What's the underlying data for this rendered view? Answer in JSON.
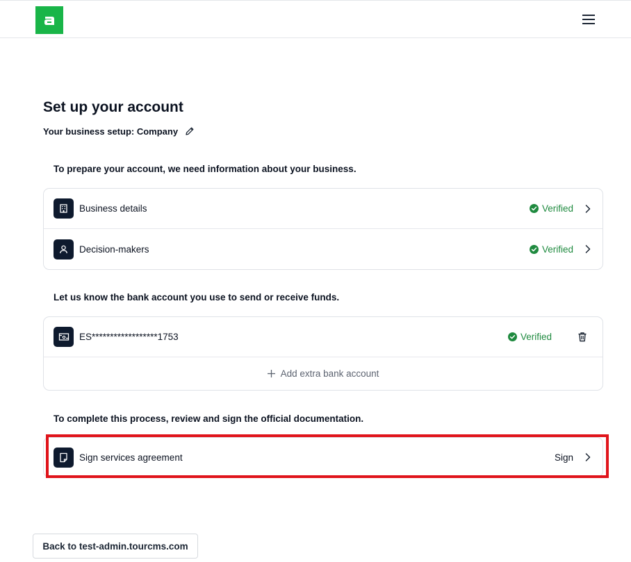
{
  "header": {
    "logo_icon": "brand-logo-icon",
    "menu_icon": "hamburger-menu-icon",
    "brand_color": "#19b548"
  },
  "page": {
    "title": "Set up your account",
    "setup_label": "Your business setup: Company",
    "edit_icon": "pencil-icon"
  },
  "business_section": {
    "heading": "To prepare your account, we need information about your business.",
    "items": [
      {
        "label": "Business details",
        "status": "Verified",
        "icon": "building-icon"
      },
      {
        "label": "Decision-makers",
        "status": "Verified",
        "icon": "person-icon"
      }
    ]
  },
  "bank_section": {
    "heading": "Let us know the bank account you use to send or receive funds.",
    "account": {
      "label": "ES******************1753",
      "status": "Verified",
      "icon": "bank-card-icon",
      "delete_icon": "trash-icon"
    },
    "add_label": "Add extra bank account"
  },
  "docs_section": {
    "heading": "To complete this process, review and sign the official documentation.",
    "item": {
      "label": "Sign services agreement",
      "action": "Sign",
      "icon": "document-icon"
    }
  },
  "footer": {
    "back_label": "Back to test-admin.tourcms.com"
  },
  "colors": {
    "verified": "#1f8a3f",
    "icon_bg": "#0e1a2e",
    "highlight": "#e0141b"
  }
}
